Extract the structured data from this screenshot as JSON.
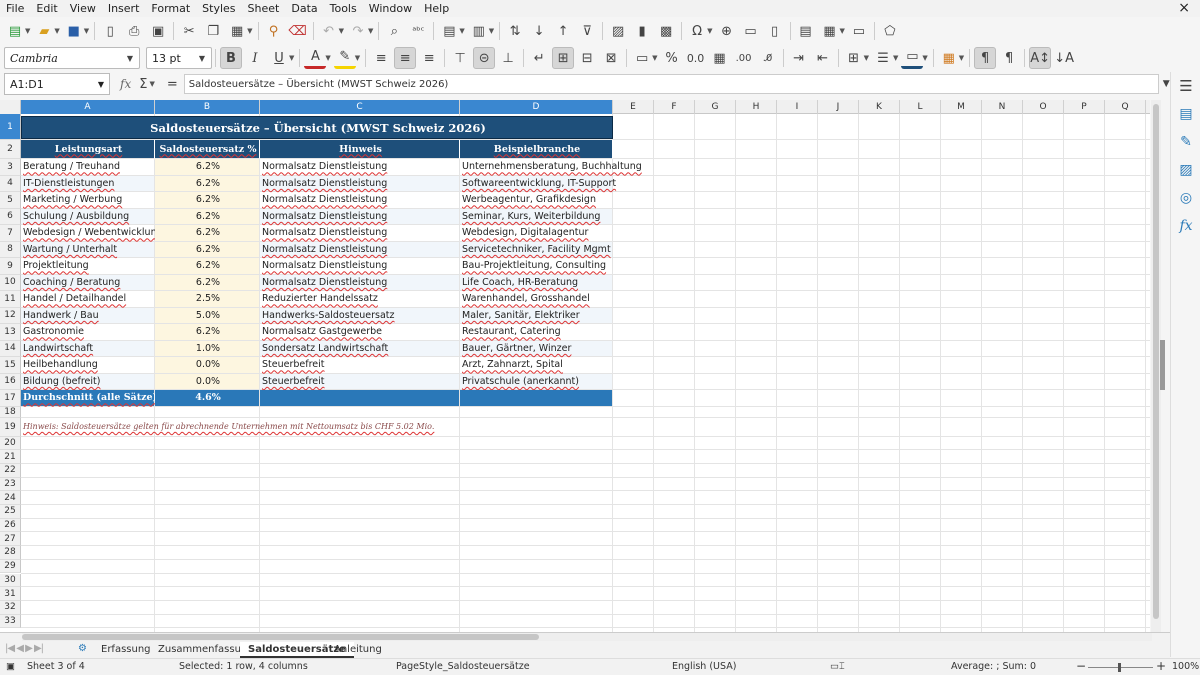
{
  "menu": [
    "File",
    "Edit",
    "View",
    "Insert",
    "Format",
    "Styles",
    "Sheet",
    "Data",
    "Tools",
    "Window",
    "Help"
  ],
  "window": {
    "close_glyph": "×"
  },
  "toolbar2": {
    "font_name": "Cambria",
    "font_size": "13 pt"
  },
  "formula": {
    "name_box": "A1:D1",
    "content": "Saldosteuersätze – Übersicht (MWST Schweiz 2026)"
  },
  "columns": [
    "A",
    "B",
    "C",
    "D",
    "E",
    "F",
    "G",
    "H",
    "I",
    "J",
    "K",
    "L",
    "M",
    "N",
    "O",
    "P",
    "Q"
  ],
  "rows": [
    "1",
    "2",
    "3",
    "4",
    "5",
    "6",
    "7",
    "8",
    "9",
    "10",
    "11",
    "12",
    "13",
    "14",
    "15",
    "16",
    "17",
    "18",
    "19",
    "20",
    "21",
    "22",
    "23",
    "24",
    "25",
    "26",
    "27",
    "28",
    "29",
    "30",
    "31",
    "32",
    "33"
  ],
  "sheet": {
    "title": "Saldosteuersätze – Übersicht (MWST Schweiz 2026)",
    "headers": [
      "Leistungsart",
      "Saldosteuersatz %",
      "Hinweis",
      "Beispielbranche"
    ],
    "data": [
      [
        "Beratung / Treuhand",
        "6.2%",
        "Normalsatz Dienstleistung",
        "Unternehmensberatung, Buchhaltung"
      ],
      [
        "IT-Dienstleistungen",
        "6.2%",
        "Normalsatz Dienstleistung",
        "Softwareentwicklung, IT-Support"
      ],
      [
        "Marketing / Werbung",
        "6.2%",
        "Normalsatz Dienstleistung",
        "Werbeagentur, Grafikdesign"
      ],
      [
        "Schulung / Ausbildung",
        "6.2%",
        "Normalsatz Dienstleistung",
        "Seminar, Kurs, Weiterbildung"
      ],
      [
        "Webdesign / Webentwicklung",
        "6.2%",
        "Normalsatz Dienstleistung",
        "Webdesign, Digitalagentur"
      ],
      [
        "Wartung / Unterhalt",
        "6.2%",
        "Normalsatz Dienstleistung",
        "Servicetechniker, Facility Mgmt"
      ],
      [
        "Projektleitung",
        "6.2%",
        "Normalsatz Dienstleistung",
        "Bau-Projektleitung, Consulting"
      ],
      [
        "Coaching / Beratung",
        "6.2%",
        "Normalsatz Dienstleistung",
        "Life Coach, HR-Beratung"
      ],
      [
        "Handel / Detailhandel",
        "2.5%",
        "Reduzierter Handelssatz",
        "Warenhandel, Grosshandel"
      ],
      [
        "Handwerk / Bau",
        "5.0%",
        "Handwerks-Saldosteuersatz",
        "Maler, Sanitär, Elektriker"
      ],
      [
        "Gastronomie",
        "6.2%",
        "Normalsatz Gastgewerbe",
        "Restaurant, Catering"
      ],
      [
        "Landwirtschaft",
        "1.0%",
        "Sondersatz Landwirtschaft",
        "Bauer, Gärtner, Winzer"
      ],
      [
        "Heilbehandlung",
        "0.0%",
        "Steuerbefreit",
        "Arzt, Zahnarzt, Spital"
      ],
      [
        "Bildung (befreit)",
        "0.0%",
        "Steuerbefreit",
        "Privatschule (anerkannt)"
      ]
    ],
    "average_label": "Durchschnitt (alle Sätze)",
    "average_value": "4.6%",
    "note": "Hinweis: Saldosteuersätze gelten für abrechnende Unternehmen mit Nettoumsatz bis CHF 5.02 Mio."
  },
  "tabs": [
    "Erfassung",
    "Zusammenfassung",
    "Saldosteuersätze",
    "Anleitung"
  ],
  "active_tab": "Saldosteuersätze",
  "status": {
    "sheet": "Sheet 3 of 4",
    "selection": "Selected: 1 row, 4 columns",
    "page_style": "PageStyle_Saldosteuersätze",
    "language": "English (USA)",
    "sum": "Average: ; Sum: 0",
    "zoom": "100%"
  },
  "colors": {
    "header_bg": "#1e4f7a",
    "avg_bg": "#2a78b8",
    "rate_bg": "#fdf6e0",
    "selection": "#3a87d0"
  }
}
